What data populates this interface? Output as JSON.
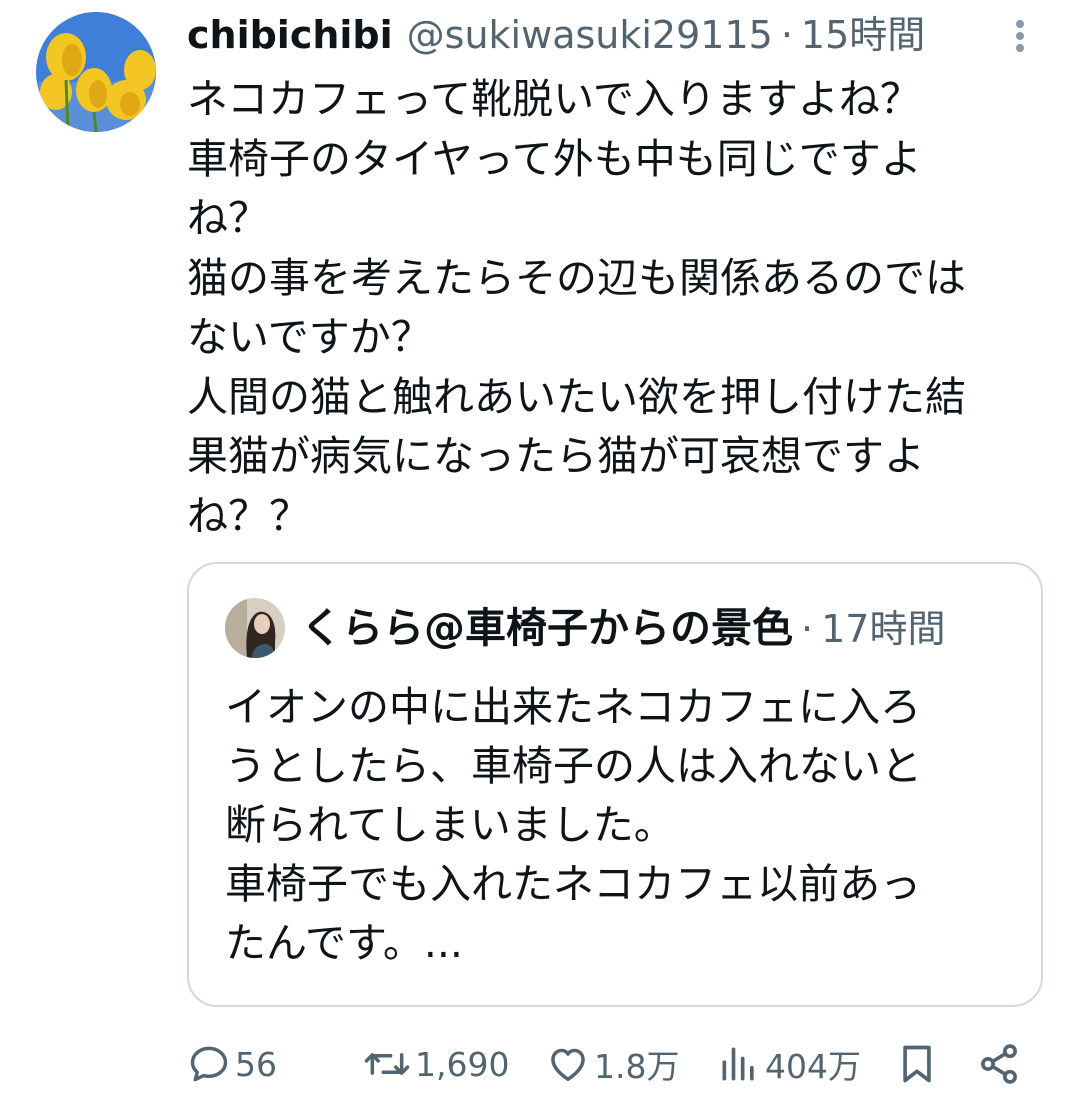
{
  "tweet": {
    "author_name": "chibichibi",
    "author_handle": "@sukiwasuki29115",
    "separator": "·",
    "time": "15時間",
    "text_lines": [
      "ネコカフェって靴脱いで入りますよね？",
      "車椅子のタイヤって外も中も同じですよ",
      "ね？",
      "猫の事を考えたらその辺も関係あるのでは",
      "ないですか？",
      "人間の猫と触れあいたい欲を押し付けた結",
      "果猫が病気になったら猫が可哀想ですよ",
      "ね？？"
    ]
  },
  "quoted_tweet": {
    "author_name": "くらら@車椅子からの景色",
    "separator": "·",
    "time": "17時間",
    "text_lines": [
      "イオンの中に出来たネコカフェに入ろ",
      "うとしたら、車椅子の人は入れないと",
      "断られてしまいました。",
      "車椅子でも入れたネコカフェ以前あっ",
      "たんです。..."
    ]
  },
  "actions": {
    "replies": "56",
    "reposts": "1,690",
    "likes": "1.8万",
    "views": "404万"
  },
  "icons": {
    "more": "more-vertical-icon",
    "reply": "reply-icon",
    "repost": "repost-icon",
    "like": "heart-icon",
    "views": "views-chart-icon",
    "bookmark": "bookmark-icon",
    "share": "share-icon"
  },
  "colors": {
    "text": "#0f1419",
    "secondary": "#536471",
    "border": "#cfd9de",
    "background": "#ffffff"
  }
}
